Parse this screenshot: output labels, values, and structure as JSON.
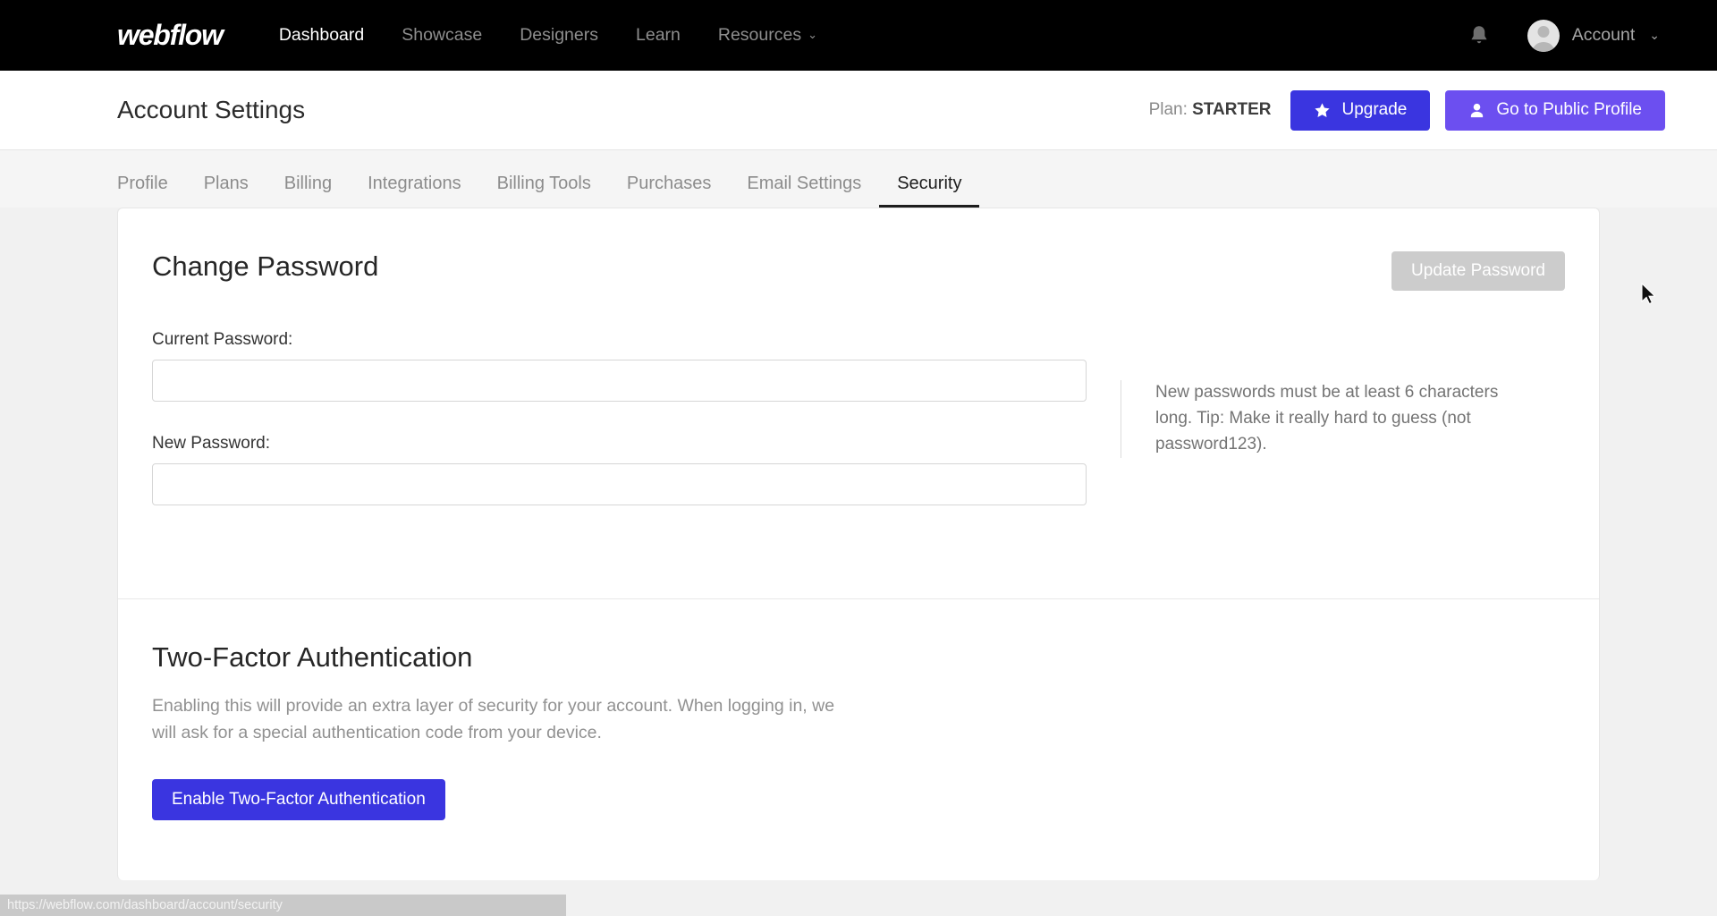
{
  "topnav": {
    "brand": "webflow",
    "links": [
      {
        "label": "Dashboard",
        "active": true
      },
      {
        "label": "Showcase",
        "active": false
      },
      {
        "label": "Designers",
        "active": false
      },
      {
        "label": "Learn",
        "active": false
      },
      {
        "label": "Resources",
        "active": false,
        "chevron": "⌄"
      }
    ],
    "notifications_icon": "bell-icon",
    "account_label": "Account",
    "account_chevron": "⌄"
  },
  "header": {
    "title": "Account Settings",
    "plan_prefix": "Plan: ",
    "plan_name": "STARTER",
    "upgrade_label": "Upgrade",
    "upgrade_icon": "star-icon",
    "public_profile_label": "Go to Public Profile",
    "public_profile_icon": "person-icon"
  },
  "tabs": [
    {
      "label": "Profile",
      "active": false
    },
    {
      "label": "Plans",
      "active": false
    },
    {
      "label": "Billing",
      "active": false
    },
    {
      "label": "Integrations",
      "active": false
    },
    {
      "label": "Billing Tools",
      "active": false
    },
    {
      "label": "Purchases",
      "active": false
    },
    {
      "label": "Email Settings",
      "active": false
    },
    {
      "label": "Security",
      "active": true
    }
  ],
  "change_password": {
    "title": "Change Password",
    "update_button": "Update Password",
    "current_label": "Current Password:",
    "current_value": "",
    "current_placeholder": "",
    "new_label": "New Password:",
    "new_value": "",
    "new_placeholder": "",
    "hint": "New passwords must be at least 6 characters long. Tip: Make it really hard to guess (not password123)."
  },
  "two_factor": {
    "title": "Two-Factor Authentication",
    "description": "Enabling this will provide an extra layer of security for your account. When logging in, we will ask for a special authentication code from your device.",
    "enable_button": "Enable Two-Factor Authentication"
  },
  "statusbar": {
    "url": "https://webflow.com/dashboard/account/security"
  },
  "colors": {
    "brand_blue": "#3a35e0",
    "profile_purple": "#6c4ff0",
    "disabled_gray": "#cccccc",
    "nav_black": "#000000",
    "page_bg": "#f1f1f1"
  }
}
